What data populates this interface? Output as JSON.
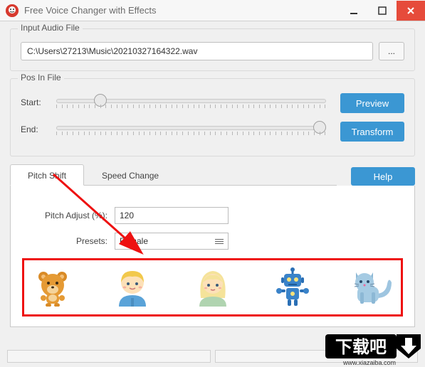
{
  "window": {
    "title": "Free Voice Changer with Effects"
  },
  "input_file": {
    "group_label": "Input Audio File",
    "path": "C:\\Users\\27213\\Music\\20210327164322.wav",
    "browse_label": "..."
  },
  "pos": {
    "group_label": "Pos In File",
    "start_label": "Start:",
    "end_label": "End:",
    "start_percent": 14,
    "end_percent": 100,
    "preview_label": "Preview",
    "transform_label": "Transform"
  },
  "tabs": {
    "pitch_tab": "Pitch Shift",
    "speed_tab": "Speed Change",
    "help_label": "Help"
  },
  "pitch": {
    "adjust_label": "Pitch Adjust (%):",
    "adjust_value": "120",
    "presets_label": "Presets:",
    "presets_value": "Female"
  },
  "presets_icons": [
    "bear",
    "boy",
    "girl",
    "robot",
    "cat"
  ],
  "watermark": {
    "text_cn": "下载吧",
    "url": "www.xiazaiba.com"
  }
}
